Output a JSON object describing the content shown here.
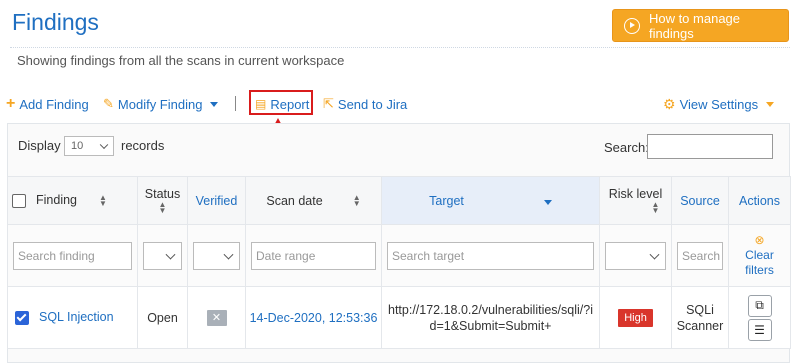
{
  "header": {
    "title": "Findings",
    "subtitle": "Showing findings from all the scans in current workspace",
    "howto_label": "How to manage findings"
  },
  "toolbar": {
    "add_label": "Add Finding",
    "modify_label": "Modify Finding",
    "report_label": "Report",
    "jira_label": "Send to Jira",
    "view_settings_label": "View Settings"
  },
  "table_controls": {
    "display_label": "Display",
    "page_length": "10",
    "records_label": "records",
    "search_label": "Search:"
  },
  "columns": {
    "finding": "Finding",
    "status": "Status",
    "verified": "Verified",
    "scan_date": "Scan date",
    "target": "Target",
    "risk_level": "Risk level",
    "source": "Source",
    "actions": "Actions"
  },
  "filters": {
    "finding_placeholder": "Search finding",
    "date_placeholder": "Date range",
    "target_placeholder": "Search target",
    "source_placeholder": "Search",
    "clear_label": "Clear filters"
  },
  "rows": [
    {
      "finding": "SQL Injection",
      "status": "Open",
      "scan_date": "14-Dec-2020, 12:53:36",
      "target": "http://172.18.0.2/vulnerabilities/sqli/?id=1&Submit=Submit+",
      "risk": "High",
      "source": "SQLi Scanner"
    }
  ],
  "colors": {
    "accent_blue": "#1f6fc1",
    "orange": "#f5a623",
    "highlight_red": "#d91c1c",
    "risk_high": "#d9352b"
  }
}
